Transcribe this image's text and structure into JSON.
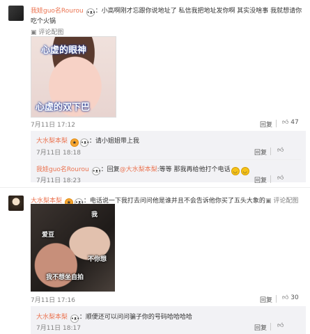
{
  "comment1": {
    "user": "我娃guo名Rourou",
    "text": "：小高啊刚才忘跟你说地址了 私信我把地址发你啊 其实没啥事 我就想请你吃个火锅",
    "text_line1": "：小高啊刚才忘跟你说地址了 私信我把地址发你啊 其实没啥事 我就想请你",
    "text_line2": "吃个火锅",
    "image_text_top": "心虚的眼神",
    "image_text_bottom": "心虚的双下巴",
    "time": "7月11日 17:12",
    "reply": "回复",
    "likes": "47"
  },
  "reply1": {
    "user": "大水梨本梨",
    "text": "：请小姐姐带上我",
    "time": "7月11日 18:18",
    "reply": "回复"
  },
  "reply2": {
    "user": "我娃guo名Rourou",
    "text_prefix": "：回复",
    "mention": "@大水梨本梨",
    "text": ":等等 那我再给他打个电话",
    "time": "7月11日 18:23",
    "reply": "回复"
  },
  "comment2": {
    "user": "大水梨本梨",
    "text": "：电话说一下我打去问问他是谁并且不会告诉他你买了五头大象的",
    "review_label": "评论配图",
    "image_text_me": "我",
    "image_text_idol": "爱豆",
    "image_text_notyou": "不你想",
    "image_text_bottom": "我不想坐自拍",
    "time": "7月11日 17:16",
    "reply": "回复",
    "likes": "30"
  },
  "reply3": {
    "user": "大水梨本梨",
    "text": "：顺便还可以问问骗子你的号码哈哈哈哈",
    "time": "7月11日 18:17",
    "reply": "回复"
  },
  "review_label": "评论配图",
  "colors": {
    "name": "#eb7350",
    "muted": "#808080",
    "reply_bg": "#f2f2f5"
  }
}
